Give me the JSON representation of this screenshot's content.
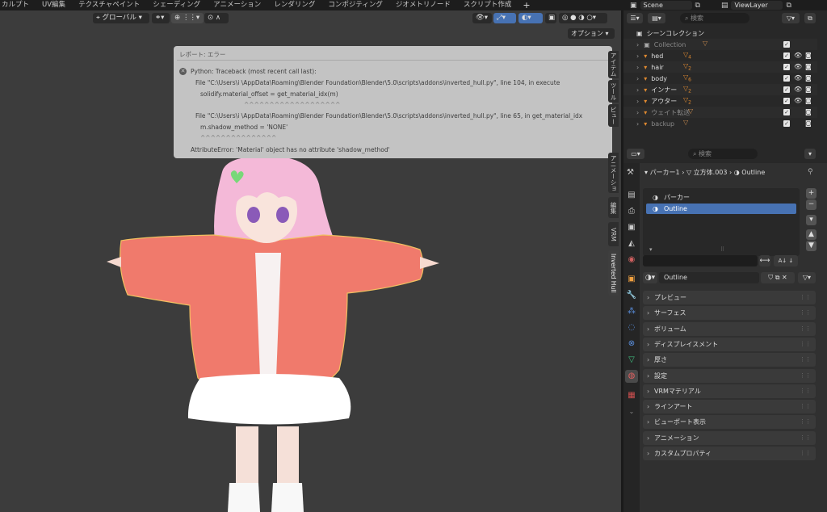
{
  "workspace_tabs": [
    "カルプト",
    "UV編集",
    "テクスチャペイント",
    "シェーディング",
    "アニメーション",
    "レンダリング",
    "コンポジティング",
    "ジオメトリノード",
    "スクリプト作成"
  ],
  "workspace_add": "+",
  "scene": {
    "name": "Scene",
    "view_layer": "ViewLayer"
  },
  "viewport": {
    "orientation_label": "グローバル",
    "options_label": "オプション"
  },
  "error_report": {
    "title": "レポート: エラー",
    "lines": [
      "Python: Traceback (most recent call last):",
      "File \"C:\\Users\\i          \\AppData\\Roaming\\Blender Foundation\\Blender\\5.0\\scripts\\addons\\inverted_hull.py\", line 104, in execute",
      "solidify.material_offset = get_material_idx(m)",
      "^^^^^^^^^^^^^^^^^^^",
      "File \"C:\\Users\\i          \\AppData\\Roaming\\Blender Foundation\\Blender\\5.0\\scripts\\addons\\inverted_hull.py\", line 65, in get_material_idx",
      "m.shadow_method = 'NONE'",
      "^^^^^^^^^^^^^^^",
      "AttributeError: 'Material' object has no attribute 'shadow_method'"
    ]
  },
  "n_panel_tabs": [
    "アイテム",
    "ツール",
    "ビュー",
    "アニメーション",
    "編集",
    "VRM",
    "Inverted Hull"
  ],
  "outliner": {
    "search_placeholder": "検索",
    "root": "シーンコレクション",
    "rows": [
      {
        "name": "Collection",
        "dim": true,
        "eye": false,
        "cam": false
      },
      {
        "name": "hed",
        "dim": false,
        "eye": true,
        "cam": true
      },
      {
        "name": "hair",
        "dim": false,
        "eye": true,
        "cam": true
      },
      {
        "name": "body",
        "dim": false,
        "eye": true,
        "cam": true
      },
      {
        "name": "インナー",
        "dim": false,
        "eye": true,
        "cam": true
      },
      {
        "name": "アウター",
        "dim": false,
        "eye": true,
        "cam": true
      },
      {
        "name": "ウェイト転送",
        "dim": true,
        "eye": false,
        "cam": true
      },
      {
        "name": "backup",
        "dim": true,
        "eye": false,
        "cam": true
      }
    ],
    "row_badges": [
      "",
      "4",
      "2",
      "6",
      "2",
      "2",
      "",
      ""
    ]
  },
  "properties": {
    "search_placeholder": "検索",
    "breadcrumb": {
      "object": "パーカー1",
      "mesh": "立方体.003",
      "material": "Outline"
    },
    "slots": [
      {
        "name": "パーカー",
        "selected": false
      },
      {
        "name": "Outline",
        "selected": true
      }
    ],
    "material_name": "Outline",
    "panels": [
      "プレビュー",
      "サーフェス",
      "ボリューム",
      "ディスプレイスメント",
      "厚さ",
      "設定",
      "VRMマテリアル",
      "ラインアート",
      "ビューポート表示",
      "アニメーション",
      "カスタムプロパティ"
    ]
  },
  "colors": {
    "accent": "#4772b3",
    "jacket": "#f07a6c",
    "hair": "#f4b9d8",
    "error_bg": "#c3c3c3"
  }
}
